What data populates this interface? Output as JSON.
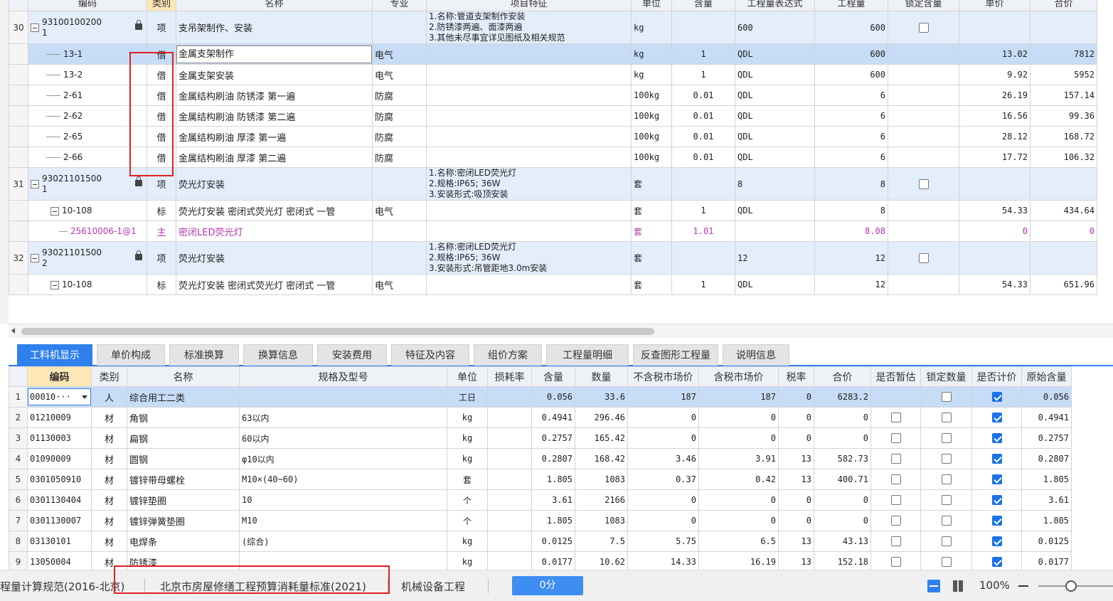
{
  "upper_grid": {
    "headers": [
      "编码",
      "类别",
      "名称",
      "专业",
      "项目特征",
      "单位",
      "含量",
      "工程量表达式",
      "工程量",
      "锁定含量",
      "单价",
      "合价"
    ],
    "rows": [
      {
        "kind": "item",
        "no": "30",
        "code": [
          "93100100200",
          "1"
        ],
        "locked": true,
        "cat": "项",
        "name": "支吊架制作、安装",
        "spec": "",
        "feature": [
          "1.名称:管道支架制作安装",
          "2.防锈漆两遍、面漆两遍",
          "3.其他未尽事宜详见图纸及相关规范"
        ],
        "unit": "kg",
        "content": "",
        "expr": "600",
        "qty": "600",
        "lockbox": true,
        "price": "",
        "total": ""
      },
      {
        "kind": "sub",
        "selected": true,
        "no": "",
        "code": [
          "13-1"
        ],
        "cat": "借",
        "name": "金属支架制作",
        "spec": "电气",
        "feature": [],
        "unit": "kg",
        "content": "1",
        "expr": "QDL",
        "qty": "600",
        "price": "13.02",
        "total": "7812"
      },
      {
        "kind": "sub",
        "no": "",
        "code": [
          "13-2"
        ],
        "cat": "借",
        "name": "金属支架安装",
        "spec": "电气",
        "feature": [],
        "unit": "kg",
        "content": "1",
        "expr": "QDL",
        "qty": "600",
        "price": "9.92",
        "total": "5952"
      },
      {
        "kind": "sub",
        "no": "",
        "code": [
          "2-61"
        ],
        "cat": "借",
        "name": "金属结构刷油 防锈漆 第一遍",
        "spec": "防腐",
        "feature": [],
        "unit": "100kg",
        "content": "0.01",
        "expr": "QDL",
        "qty": "6",
        "price": "26.19",
        "total": "157.14"
      },
      {
        "kind": "sub",
        "no": "",
        "code": [
          "2-62"
        ],
        "cat": "借",
        "name": "金属结构刷油 防锈漆 第二遍",
        "spec": "防腐",
        "feature": [],
        "unit": "100kg",
        "content": "0.01",
        "expr": "QDL",
        "qty": "6",
        "price": "16.56",
        "total": "99.36"
      },
      {
        "kind": "sub",
        "no": "",
        "code": [
          "2-65"
        ],
        "cat": "借",
        "name": "金属结构刷油 厚漆 第一遍",
        "spec": "防腐",
        "feature": [],
        "unit": "100kg",
        "content": "0.01",
        "expr": "QDL",
        "qty": "6",
        "price": "28.12",
        "total": "168.72"
      },
      {
        "kind": "sub",
        "no": "",
        "code": [
          "2-66"
        ],
        "cat": "借",
        "name": "金属结构刷油 厚漆 第二遍",
        "spec": "防腐",
        "feature": [],
        "unit": "100kg",
        "content": "0.01",
        "expr": "QDL",
        "qty": "6",
        "price": "17.72",
        "total": "106.32"
      },
      {
        "kind": "item",
        "no": "31",
        "code": [
          "93021101500",
          "1"
        ],
        "locked": true,
        "cat": "项",
        "name": "荧光灯安装",
        "spec": "",
        "feature": [
          "1.名称:密闭LED荧光灯",
          "2.规格:IP65; 36W",
          "3.安装形式:吸顶安装"
        ],
        "unit": "套",
        "content": "",
        "expr": "8",
        "qty": "8",
        "lockbox": true,
        "price": "",
        "total": ""
      },
      {
        "kind": "quota",
        "no": "",
        "code": [
          "10-108"
        ],
        "cat": "标",
        "name": "荧光灯安装 密闭式荧光灯 密闭式 一管",
        "spec": "电气",
        "feature": [],
        "unit": "套",
        "content": "1",
        "expr": "QDL",
        "qty": "8",
        "price": "54.33",
        "total": "434.64"
      },
      {
        "kind": "main",
        "no": "",
        "code": [
          "25610006-1@1"
        ],
        "cat": "主",
        "name": "密闭LED荧光灯",
        "spec": "",
        "feature": [],
        "unit": "套",
        "content": "1.01",
        "expr": "",
        "qty": "8.08",
        "price": "0",
        "total": "0"
      },
      {
        "kind": "item",
        "no": "32",
        "code": [
          "93021101500",
          "2"
        ],
        "locked": true,
        "cat": "项",
        "name": "荧光灯安装",
        "spec": "",
        "feature": [
          "1.名称:密闭LED荧光灯",
          "2.规格:IP65; 36W",
          "3.安装形式:吊管距地3.0m安装"
        ],
        "unit": "套",
        "content": "",
        "expr": "12",
        "qty": "12",
        "lockbox": true,
        "price": "",
        "total": ""
      },
      {
        "kind": "quota",
        "no": "",
        "code": [
          "10-108"
        ],
        "cat": "标",
        "name": "荧光灯安装 密闭式荧光灯 密闭式 一管",
        "spec": "电气",
        "feature": [],
        "unit": "套",
        "content": "1",
        "expr": "QDL",
        "qty": "12",
        "price": "54.33",
        "total": "651.96"
      }
    ]
  },
  "tabs": [
    "工料机显示",
    "单价构成",
    "标准换算",
    "换算信息",
    "安装费用",
    "特征及内容",
    "组价方案",
    "工程量明细",
    "反查图形工程量",
    "说明信息"
  ],
  "active_tab": 0,
  "lower_grid": {
    "headers": [
      "",
      "编码",
      "类别",
      "名称",
      "规格及型号",
      "单位",
      "损耗率",
      "含量",
      "数量",
      "不含税市场价",
      "含税市场价",
      "税率",
      "合价",
      "是否暂估",
      "锁定数量",
      "是否计价",
      "原始含量"
    ],
    "rows": [
      {
        "no": "1",
        "code": "00010···",
        "cat": "人",
        "name": "综合用工二类",
        "spec": "",
        "unit": "工日",
        "loss": "",
        "content": "0.056",
        "qty": "33.6",
        "price_ex": "187",
        "price_in": "187",
        "tax": "0",
        "total": "6283.2",
        "est": null,
        "lock": false,
        "charge": true,
        "orig": "0.056"
      },
      {
        "no": "2",
        "code": "01210009",
        "cat": "材",
        "name": "角钢",
        "spec": "63以内",
        "unit": "kg",
        "loss": "",
        "content": "0.4941",
        "qty": "296.46",
        "price_ex": "0",
        "price_in": "0",
        "tax": "0",
        "total": "0",
        "est": false,
        "lock": false,
        "charge": true,
        "orig": "0.4941"
      },
      {
        "no": "3",
        "code": "01130003",
        "cat": "材",
        "name": "扁钢",
        "spec": "60以内",
        "unit": "kg",
        "loss": "",
        "content": "0.2757",
        "qty": "165.42",
        "price_ex": "0",
        "price_in": "0",
        "tax": "0",
        "total": "0",
        "est": false,
        "lock": false,
        "charge": true,
        "orig": "0.2757"
      },
      {
        "no": "4",
        "code": "01090009",
        "cat": "材",
        "name": "圆钢",
        "spec": "φ10以内",
        "unit": "kg",
        "loss": "",
        "content": "0.2807",
        "qty": "168.42",
        "price_ex": "3.46",
        "price_in": "3.91",
        "tax": "13",
        "total": "582.73",
        "est": false,
        "lock": false,
        "charge": true,
        "orig": "0.2807"
      },
      {
        "no": "5",
        "code": "0301050910",
        "cat": "材",
        "name": "镀锌带母螺栓",
        "spec": "M10×(40~60)",
        "unit": "套",
        "loss": "",
        "content": "1.805",
        "qty": "1083",
        "price_ex": "0.37",
        "price_in": "0.42",
        "tax": "13",
        "total": "400.71",
        "est": false,
        "lock": false,
        "charge": true,
        "orig": "1.805"
      },
      {
        "no": "6",
        "code": "0301130404",
        "cat": "材",
        "name": "镀锌垫圈",
        "spec": "10",
        "unit": "个",
        "loss": "",
        "content": "3.61",
        "qty": "2166",
        "price_ex": "0",
        "price_in": "0",
        "tax": "0",
        "total": "0",
        "est": false,
        "lock": false,
        "charge": true,
        "orig": "3.61"
      },
      {
        "no": "7",
        "code": "0301130007",
        "cat": "材",
        "name": "镀锌弹簧垫圈",
        "spec": "M10",
        "unit": "个",
        "loss": "",
        "content": "1.805",
        "qty": "1083",
        "price_ex": "0",
        "price_in": "0",
        "tax": "0",
        "total": "0",
        "est": false,
        "lock": false,
        "charge": true,
        "orig": "1.805"
      },
      {
        "no": "8",
        "code": "03130101",
        "cat": "材",
        "name": "电焊条",
        "spec": "(综合)",
        "unit": "kg",
        "loss": "",
        "content": "0.0125",
        "qty": "7.5",
        "price_ex": "5.75",
        "price_in": "6.5",
        "tax": "13",
        "total": "43.13",
        "est": false,
        "lock": false,
        "charge": true,
        "orig": "0.0125"
      },
      {
        "no": "9",
        "code": "13050004",
        "cat": "材",
        "name": "防锈漆",
        "spec": "",
        "unit": "kg",
        "loss": "",
        "content": "0.0177",
        "qty": "10.62",
        "price_ex": "14.33",
        "price_in": "16.19",
        "tax": "13",
        "total": "152.18",
        "est": false,
        "lock": false,
        "charge": true,
        "orig": "0.0177"
      }
    ]
  },
  "status_bar": {
    "item1": "程量计算规范(2016-北京)",
    "item2": "北京市房屋修缮工程预算消耗量标准(2021)",
    "item3": "机械设备工程",
    "score": "0分",
    "zoom": "100%"
  },
  "colors": {
    "accent": "#2f80ed",
    "highlight_box": "#e02020",
    "main_material": "#b236b2",
    "item_row": "#e3edfb",
    "selected_row": "#c7dcf6"
  }
}
